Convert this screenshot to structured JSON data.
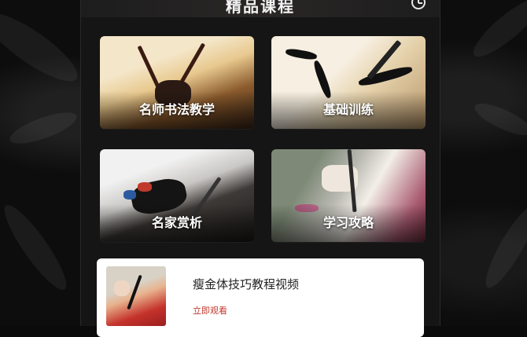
{
  "header": {
    "title": "精品课程",
    "history_icon": "clock-icon"
  },
  "grid": [
    {
      "label": "名师书法教学",
      "image": "brushes-and-scroll-photo"
    },
    {
      "label": "基础训练",
      "image": "calligraphy-strokes-photo"
    },
    {
      "label": "名家赏析",
      "image": "ink-stone-desk-photo"
    },
    {
      "label": "学习攻略",
      "image": "hand-writing-photo"
    }
  ],
  "course": {
    "title": "瘦金体技巧教程视频",
    "action": "立即观看",
    "action_color": "#c0382b"
  }
}
